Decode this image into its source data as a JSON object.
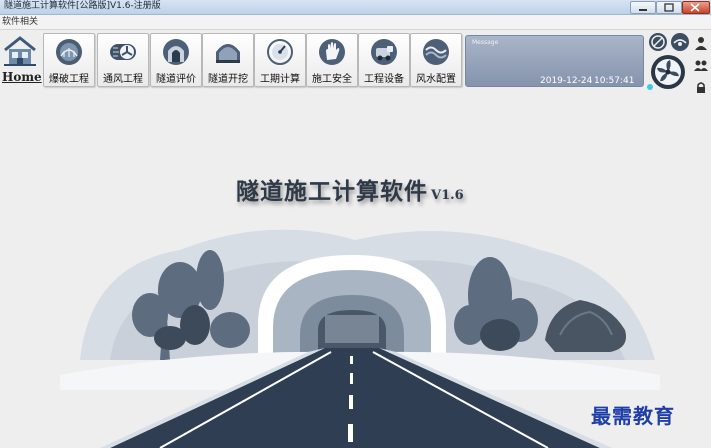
{
  "window": {
    "title": "隧道施工计算软件[公路版]V1.6-注册版"
  },
  "menu": {
    "item": "软件相关"
  },
  "toolbar": {
    "home": "Home",
    "buttons": [
      {
        "label": "爆破工程",
        "icon": "blasting-icon"
      },
      {
        "label": "通风工程",
        "icon": "ventilation-fan-icon"
      },
      {
        "label": "隧道评价",
        "icon": "tunnel-evaluation-icon"
      },
      {
        "label": "隧道开挖",
        "icon": "tunnel-excavation-icon"
      },
      {
        "label": "工期计算",
        "icon": "schedule-gauge-icon"
      },
      {
        "label": "施工安全",
        "icon": "safety-glove-icon"
      },
      {
        "label": "工程设备",
        "icon": "equipment-icon"
      },
      {
        "label": "风水配置",
        "icon": "water-wind-icon"
      }
    ]
  },
  "message": {
    "label": "Message",
    "date": "2019-12-24",
    "time": "10:57:41"
  },
  "main": {
    "title": "隧道施工计算软件",
    "version": "V1.6"
  },
  "watermark": "最需教育",
  "colors": {
    "title_bar": "#bcd2ea",
    "message_panel": "#8593ad",
    "watermark": "#1f3ea8",
    "road": "#2f3e52"
  }
}
